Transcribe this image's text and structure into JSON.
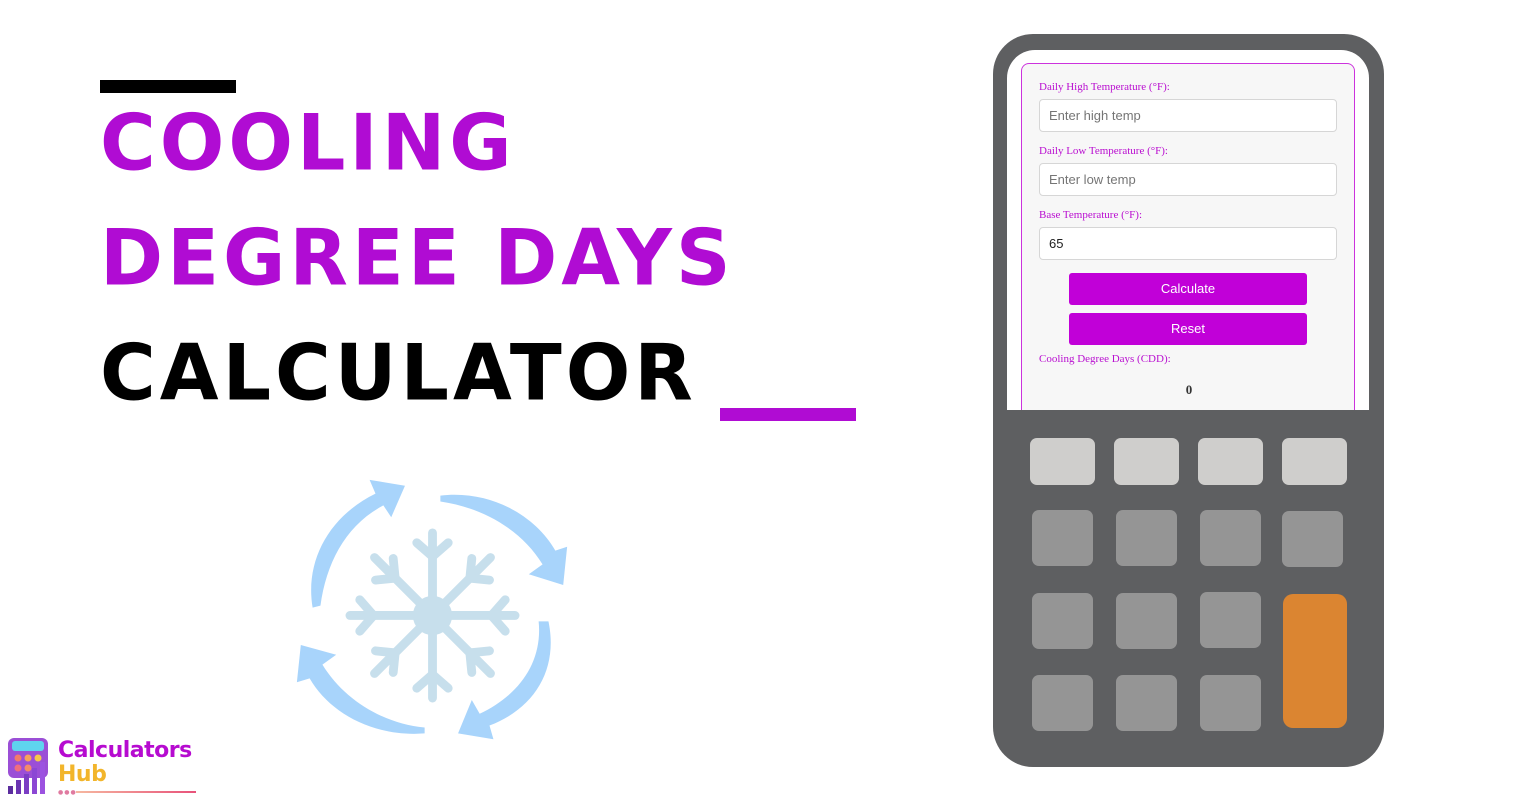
{
  "banner": {
    "title_line1": "COOLING",
    "title_line2": "DEGREE DAYS",
    "title_line3": "CALCULATOR",
    "accent_color": "#b00cd3"
  },
  "illustration": {
    "icons": [
      "snowflake-icon",
      "cycle-arrows-icon"
    ]
  },
  "logo": {
    "line1": "Calculators",
    "line2": "Hub"
  },
  "calculator": {
    "fields": [
      {
        "label": "Daily High Temperature (°F):",
        "placeholder": "Enter high temp",
        "value": ""
      },
      {
        "label": "Daily Low Temperature (°F):",
        "placeholder": "Enter low temp",
        "value": ""
      },
      {
        "label": "Base Temperature (°F):",
        "placeholder": "",
        "value": "65"
      }
    ],
    "calculate_label": "Calculate",
    "reset_label": "Reset",
    "result_label": "Cooling Degree Days (CDD):",
    "result_value": "0",
    "button_color": "#c100d8",
    "accent_key_color": "#db8531"
  }
}
